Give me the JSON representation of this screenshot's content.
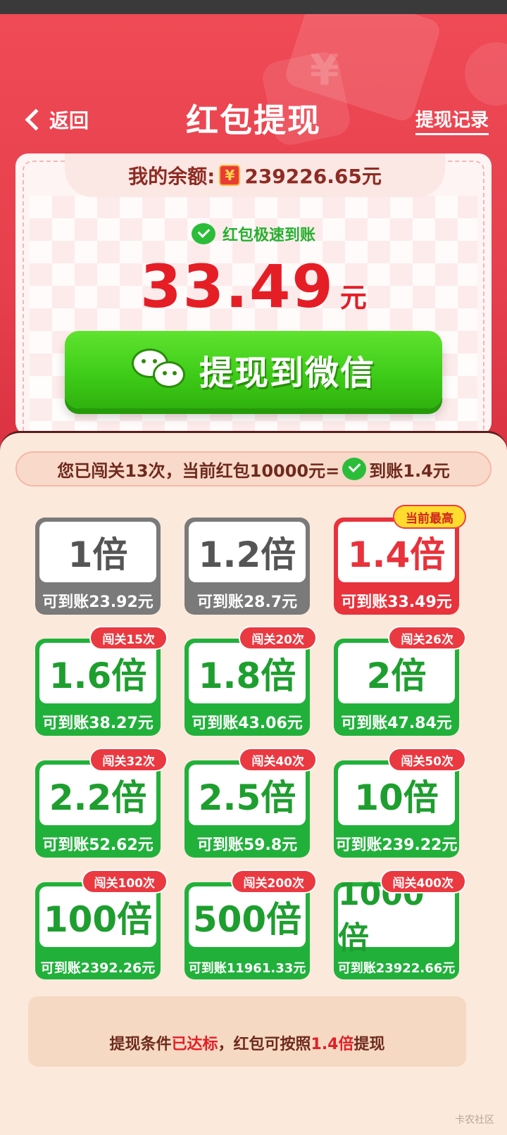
{
  "header": {
    "back_label": "返回",
    "title": "红包提现",
    "record_link": "提现记录"
  },
  "balance": {
    "label": "我的余额:",
    "currency_icon": "¥",
    "amount": "239226.65元"
  },
  "speed_text": "红包极速到账",
  "withdraw_amount": {
    "value": "33.49",
    "unit": "元"
  },
  "withdraw_button": "提现到微信",
  "info_bar": {
    "prefix": "您已闯关13次，当前红包10000元=",
    "suffix": "到账1.4元"
  },
  "tiles": [
    {
      "mult": "1倍",
      "amount": "可到账23.92元",
      "style": "gray"
    },
    {
      "mult": "1.2倍",
      "amount": "可到账28.7元",
      "style": "gray"
    },
    {
      "mult": "1.4倍",
      "amount": "可到账33.49元",
      "style": "red",
      "badge": "当前最高"
    },
    {
      "mult": "1.6倍",
      "amount": "可到账38.27元",
      "style": "green",
      "badge": "闯关15次"
    },
    {
      "mult": "1.8倍",
      "amount": "可到账43.06元",
      "style": "green",
      "badge": "闯关20次"
    },
    {
      "mult": "2倍",
      "amount": "可到账47.84元",
      "style": "green",
      "badge": "闯关26次"
    },
    {
      "mult": "2.2倍",
      "amount": "可到账52.62元",
      "style": "green",
      "badge": "闯关32次"
    },
    {
      "mult": "2.5倍",
      "amount": "可到账59.8元",
      "style": "green",
      "badge": "闯关40次"
    },
    {
      "mult": "10倍",
      "amount": "可到账239.22元",
      "style": "green",
      "badge": "闯关50次"
    },
    {
      "mult": "100倍",
      "amount": "可到账2392.26元",
      "style": "green",
      "badge": "闯关100次"
    },
    {
      "mult": "500倍",
      "amount": "可到账11961.33元",
      "style": "green",
      "badge": "闯关200次"
    },
    {
      "mult": "1000倍",
      "amount": "可到账23922.66元",
      "style": "green",
      "badge": "闯关400次"
    }
  ],
  "condition": {
    "p1": "提现条件",
    "hl1": "已达标",
    "p2": "，红包可按照",
    "hl2": "1.4倍",
    "p3": "提现"
  },
  "watermark": "卡农社区",
  "colors": {
    "hero_red": "#e63f4d",
    "green": "#21b13b",
    "amount_red": "#e51e26"
  }
}
